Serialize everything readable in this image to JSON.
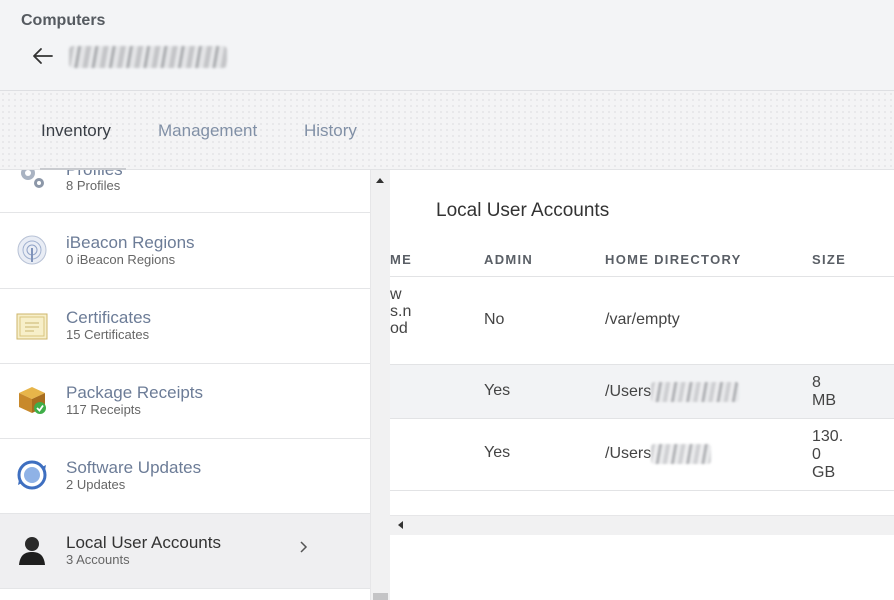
{
  "header": {
    "breadcrumb": "Computers",
    "back_icon": "arrow-left-icon"
  },
  "tabs": [
    {
      "label": "Inventory",
      "active": true
    },
    {
      "label": "Management",
      "active": false
    },
    {
      "label": "History",
      "active": false
    }
  ],
  "sidebar": {
    "items": [
      {
        "title": "Profiles",
        "subtitle": "8 Profiles",
        "icon": "gears-icon"
      },
      {
        "title": "iBeacon Regions",
        "subtitle": "0 iBeacon Regions",
        "icon": "ibeacon-icon"
      },
      {
        "title": "Certificates",
        "subtitle": "15 Certificates",
        "icon": "certificate-icon"
      },
      {
        "title": "Package Receipts",
        "subtitle": "117 Receipts",
        "icon": "package-icon"
      },
      {
        "title": "Software Updates",
        "subtitle": "2 Updates",
        "icon": "software-update-icon"
      },
      {
        "title": "Local User Accounts",
        "subtitle": "3 Accounts",
        "icon": "user-icon",
        "active": true
      }
    ]
  },
  "main": {
    "title": "Local User Accounts",
    "columns": [
      "ME",
      "ADMIN",
      "HOME DIRECTORY",
      "SIZE"
    ],
    "rows": [
      {
        "name_lines": [
          "w",
          "s.n",
          "od"
        ],
        "admin": "No",
        "home": "/var/empty",
        "size": ""
      },
      {
        "name_lines": [],
        "admin": "Yes",
        "home": "/Users",
        "size": "8\nMB"
      },
      {
        "name_lines": [],
        "admin": "Yes",
        "home": "/Users",
        "size": "130.\n0\nGB"
      }
    ]
  },
  "colors": {
    "link": "#6c7c97",
    "active_tab": "#3a3f46",
    "inactive_tab": "#8190a6"
  }
}
